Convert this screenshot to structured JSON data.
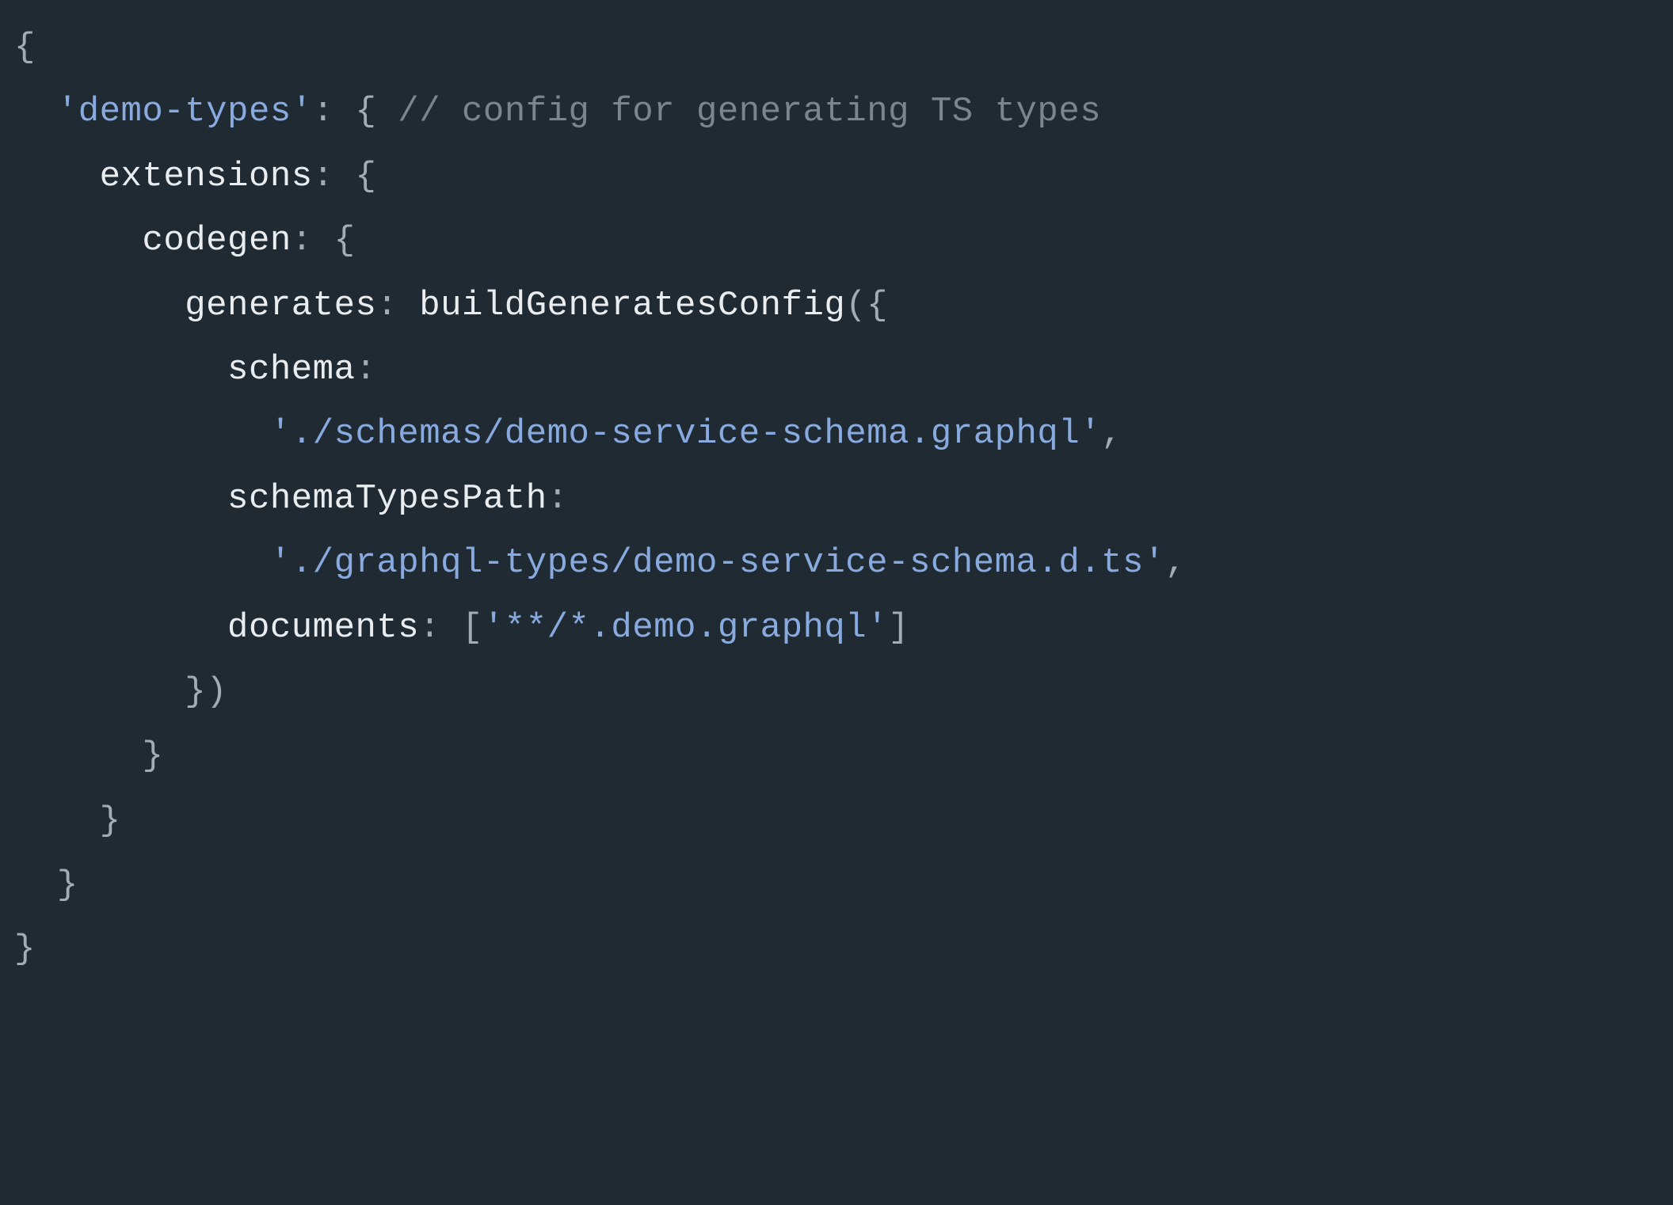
{
  "code": {
    "lines": [
      {
        "indent": 0,
        "tokens": [
          {
            "t": "{",
            "c": "punc"
          }
        ]
      },
      {
        "indent": 1,
        "tokens": [
          {
            "t": "'demo-types'",
            "c": "string"
          },
          {
            "t": ":",
            "c": "punc"
          },
          {
            "t": " ",
            "c": "default"
          },
          {
            "t": "{",
            "c": "punc"
          },
          {
            "t": " ",
            "c": "default"
          },
          {
            "t": "// config for generating TS types",
            "c": "comment"
          }
        ]
      },
      {
        "indent": 2,
        "tokens": [
          {
            "t": "extensions",
            "c": "default"
          },
          {
            "t": ":",
            "c": "punc"
          },
          {
            "t": " ",
            "c": "default"
          },
          {
            "t": "{",
            "c": "punc"
          }
        ]
      },
      {
        "indent": 3,
        "tokens": [
          {
            "t": "codegen",
            "c": "default"
          },
          {
            "t": ":",
            "c": "punc"
          },
          {
            "t": " ",
            "c": "default"
          },
          {
            "t": "{",
            "c": "punc"
          }
        ]
      },
      {
        "indent": 4,
        "tokens": [
          {
            "t": "generates",
            "c": "default"
          },
          {
            "t": ":",
            "c": "punc"
          },
          {
            "t": " ",
            "c": "default"
          },
          {
            "t": "buildGeneratesConfig",
            "c": "default"
          },
          {
            "t": "({",
            "c": "punc"
          }
        ]
      },
      {
        "indent": 5,
        "tokens": [
          {
            "t": "schema",
            "c": "default"
          },
          {
            "t": ":",
            "c": "punc"
          }
        ]
      },
      {
        "indent": 6,
        "tokens": [
          {
            "t": "'./schemas/demo-service-schema.graphql'",
            "c": "string"
          },
          {
            "t": ",",
            "c": "punc"
          }
        ]
      },
      {
        "indent": 5,
        "tokens": [
          {
            "t": "schemaTypesPath",
            "c": "default"
          },
          {
            "t": ":",
            "c": "punc"
          }
        ]
      },
      {
        "indent": 6,
        "tokens": [
          {
            "t": "'./graphql-types/demo-service-schema.d.ts'",
            "c": "string"
          },
          {
            "t": ",",
            "c": "punc"
          }
        ]
      },
      {
        "indent": 5,
        "tokens": [
          {
            "t": "documents",
            "c": "default"
          },
          {
            "t": ":",
            "c": "punc"
          },
          {
            "t": " ",
            "c": "default"
          },
          {
            "t": "[",
            "c": "punc"
          },
          {
            "t": "'**/*.demo.graphql'",
            "c": "string"
          },
          {
            "t": "]",
            "c": "punc"
          }
        ]
      },
      {
        "indent": 4,
        "tokens": [
          {
            "t": "})",
            "c": "punc"
          }
        ]
      },
      {
        "indent": 3,
        "tokens": [
          {
            "t": "}",
            "c": "punc"
          }
        ]
      },
      {
        "indent": 2,
        "tokens": [
          {
            "t": "}",
            "c": "punc"
          }
        ]
      },
      {
        "indent": 1,
        "tokens": [
          {
            "t": "}",
            "c": "punc"
          }
        ]
      },
      {
        "indent": 0,
        "tokens": [
          {
            "t": "}",
            "c": "punc"
          }
        ]
      }
    ],
    "indentUnit": "  "
  }
}
